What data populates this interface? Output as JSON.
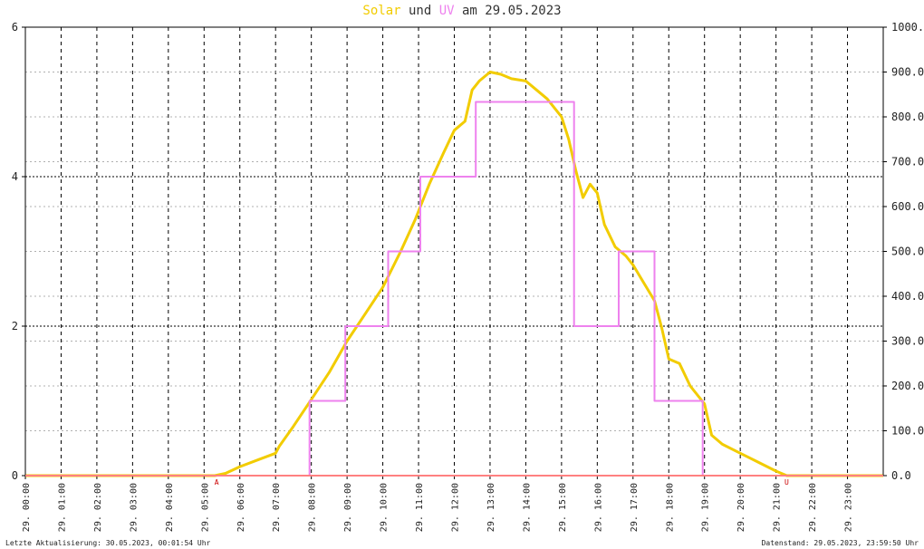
{
  "title": {
    "part1": "Solar",
    "part2": " und ",
    "part3": "UV",
    "part4": " am 29.05.2023"
  },
  "footer": {
    "left": "Letzte Aktualisierung: 30.05.2023, 00:01:54 Uhr",
    "right": "Datenstand: 29.05.2023, 23:59:50 Uhr"
  },
  "colors": {
    "solar": "#f2cc00",
    "uv": "#ee82ee",
    "baseline": "#ff8080",
    "marker": "#cc0000"
  },
  "chart_data": {
    "type": "line",
    "xlim": [
      0,
      24
    ],
    "x_ticks": [
      "29. 00:00",
      "29. 01:00",
      "29. 02:00",
      "29. 03:00",
      "29. 04:00",
      "29. 05:00",
      "29. 06:00",
      "29. 07:00",
      "29. 08:00",
      "29. 09:00",
      "29. 10:00",
      "29. 11:00",
      "29. 12:00",
      "29. 13:00",
      "29. 14:00",
      "29. 15:00",
      "29. 16:00",
      "29. 17:00",
      "29. 18:00",
      "29. 19:00",
      "29. 20:00",
      "29. 21:00",
      "29. 22:00",
      "29. 23:00"
    ],
    "y_left": {
      "lim": [
        0,
        6
      ],
      "ticks": [
        "0",
        "2",
        "4",
        "6"
      ]
    },
    "y_right": {
      "lim": [
        0,
        1000
      ],
      "ticks": [
        "0.0",
        "100.0",
        "200.0",
        "300.0",
        "400.0",
        "500.0",
        "600.0",
        "700.0",
        "800.0",
        "900.0",
        "1000.0"
      ]
    },
    "markers": [
      {
        "label": "A",
        "x": 5.35
      },
      {
        "label": "U",
        "x": 21.3
      }
    ],
    "series": [
      {
        "name": "Solar",
        "axis": "right",
        "x": [
          0,
          5.3,
          5.6,
          6.0,
          6.5,
          7.0,
          7.1,
          7.5,
          8.0,
          8.5,
          9.0,
          9.5,
          10.0,
          10.5,
          10.9,
          11.3,
          11.7,
          12.0,
          12.3,
          12.5,
          12.7,
          13.0,
          13.3,
          13.6,
          14.0,
          14.3,
          14.6,
          15.0,
          15.2,
          15.4,
          15.6,
          15.8,
          16.0,
          16.2,
          16.5,
          16.8,
          17.0,
          17.3,
          17.6,
          17.8,
          18.0,
          18.3,
          18.6,
          19.0,
          19.2,
          19.5,
          20.0,
          20.5,
          21.0,
          21.3,
          24
        ],
        "y": [
          0,
          0,
          5,
          20,
          35,
          50,
          65,
          110,
          170,
          230,
          300,
          360,
          420,
          500,
          570,
          650,
          720,
          770,
          790,
          860,
          880,
          900,
          895,
          885,
          880,
          860,
          840,
          800,
          750,
          680,
          620,
          650,
          630,
          560,
          510,
          490,
          470,
          430,
          390,
          330,
          260,
          250,
          200,
          160,
          90,
          70,
          50,
          30,
          10,
          0,
          0
        ]
      },
      {
        "name": "UV",
        "axis": "left",
        "x": [
          0,
          7.95,
          7.95,
          8.95,
          8.95,
          10.15,
          10.15,
          11.05,
          11.05,
          12.6,
          12.6,
          15.35,
          15.35,
          16.6,
          16.6,
          17.6,
          17.6,
          18.95,
          18.95,
          24
        ],
        "y": [
          0,
          0,
          1,
          1,
          2,
          2,
          3,
          3,
          4,
          4,
          5,
          5,
          2,
          2,
          3,
          3,
          1,
          1,
          0,
          0
        ]
      }
    ]
  }
}
